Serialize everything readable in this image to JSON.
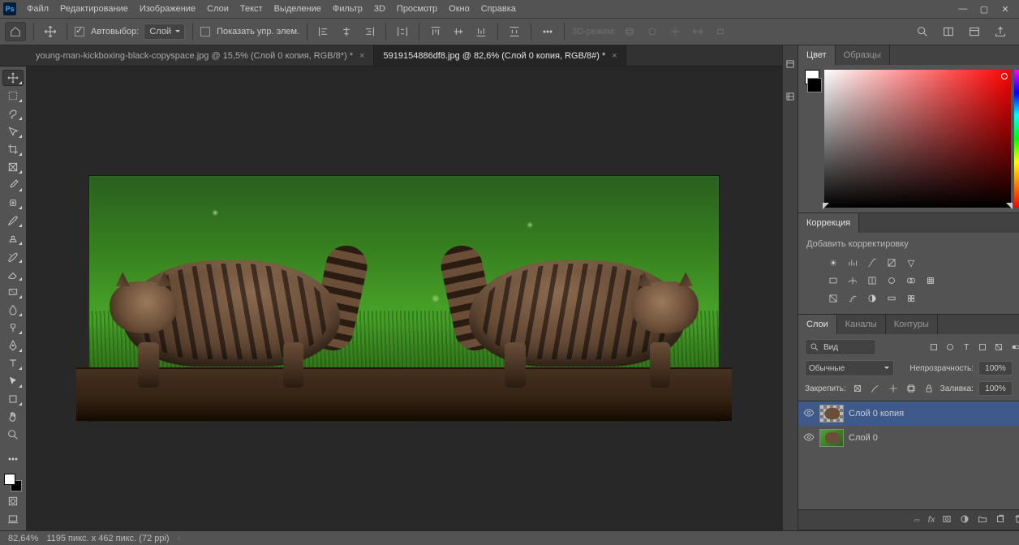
{
  "menu": {
    "items": [
      "Файл",
      "Редактирование",
      "Изображение",
      "Слои",
      "Текст",
      "Выделение",
      "Фильтр",
      "3D",
      "Просмотр",
      "Окно",
      "Справка"
    ]
  },
  "options": {
    "autoselect_label": "Автовыбор:",
    "autoselect_target": "Слой",
    "show_controls_label": "Показать упр. элем.",
    "three_d_label": "3D-режим:"
  },
  "tabs": [
    {
      "label": "young-man-kickboxing-black-copyspace.jpg @ 15,5% (Слой 0 копия, RGB/8*) *",
      "active": false
    },
    {
      "label": "5919154886df8.jpg @ 82,6% (Слой 0 копия, RGB/8#) *",
      "active": true
    }
  ],
  "panels": {
    "color": {
      "tabs": [
        "Цвет",
        "Образцы"
      ]
    },
    "corrections": {
      "title": "Коррекция",
      "hint": "Добавить корректировку"
    },
    "layers": {
      "tabs": [
        "Слои",
        "Каналы",
        "Контуры"
      ],
      "filter_label": "Вид",
      "blend_mode": "Обычные",
      "opacity_label": "Непрозрачность:",
      "opacity_value": "100%",
      "lock_label": "Закрепить:",
      "fill_label": "Заливка:",
      "fill_value": "100%",
      "items": [
        {
          "name": "Слой 0 копия",
          "active": true
        },
        {
          "name": "Слой 0",
          "active": false
        }
      ]
    }
  },
  "status": {
    "zoom": "82,64%",
    "dims": "1195 пикс. x 462 пикс. (72 ppi)"
  }
}
